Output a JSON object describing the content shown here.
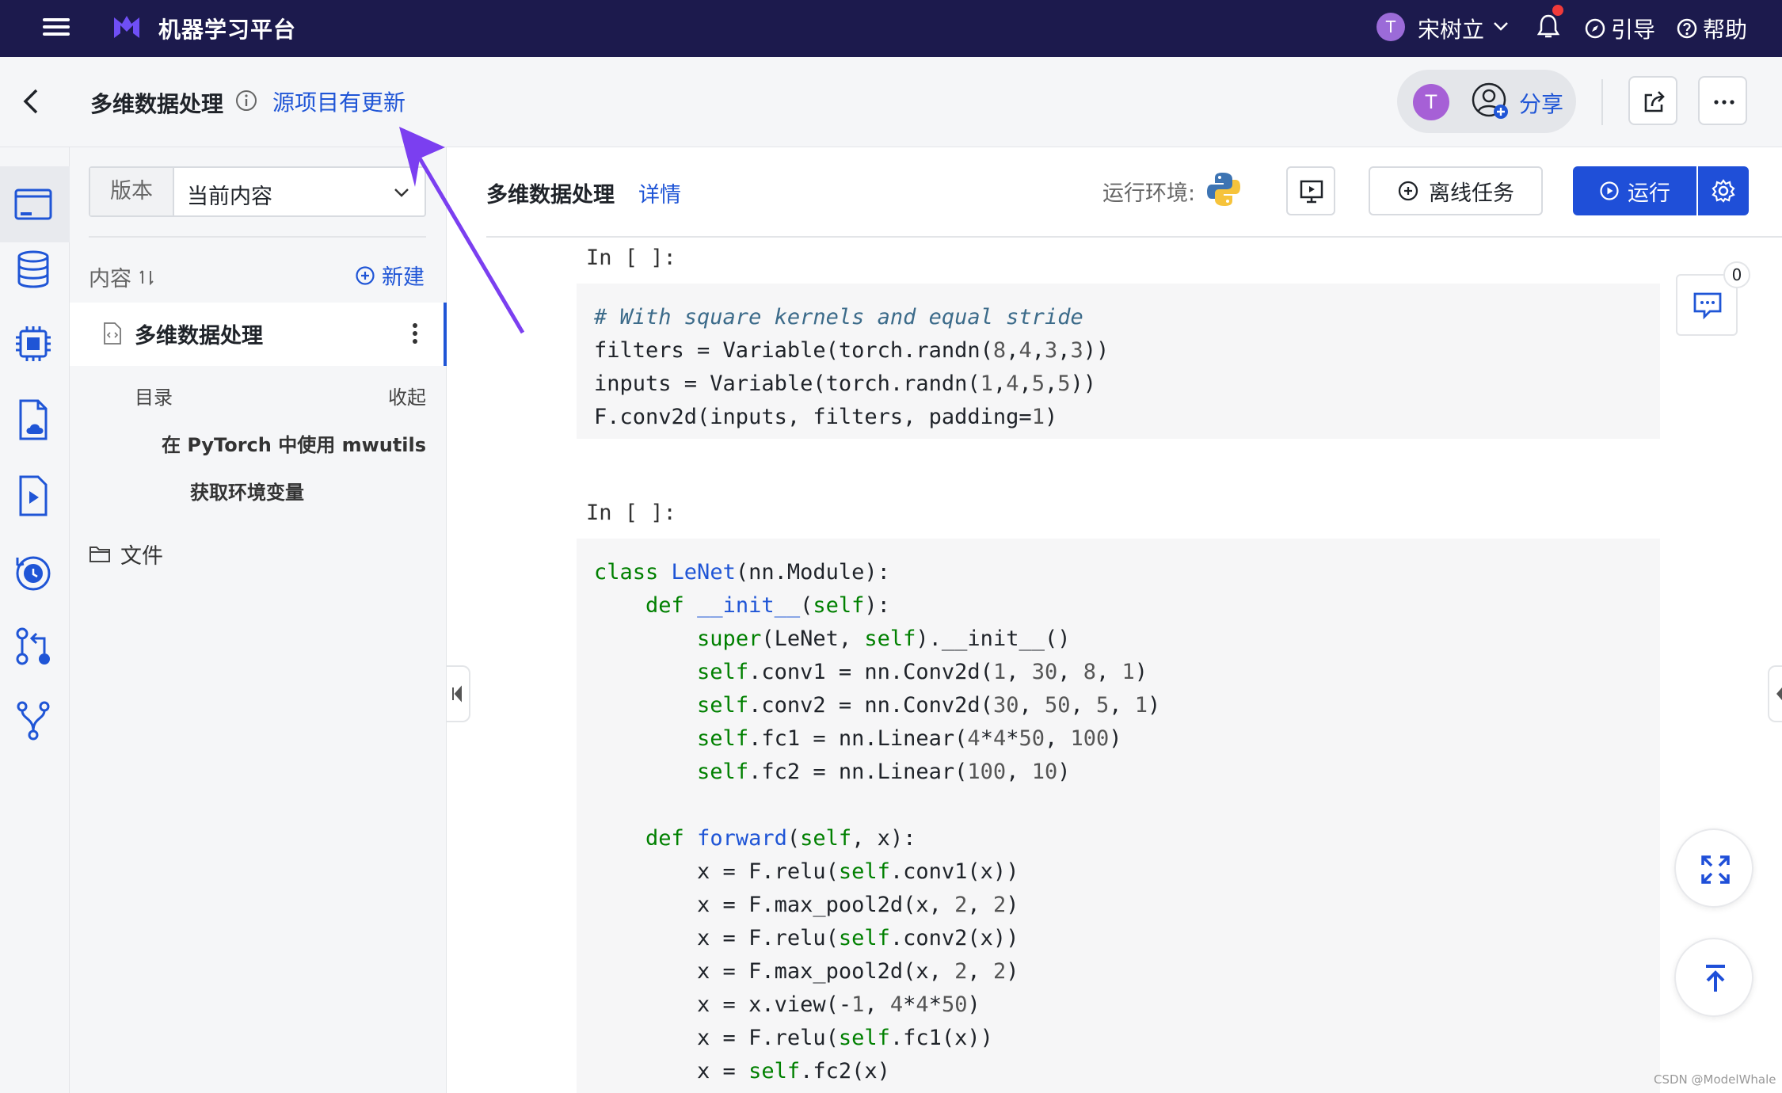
{
  "topbar": {
    "app_title": "机器学习平台",
    "user_initial": "T",
    "user_name": "宋树立",
    "guide_label": "引导",
    "help_label": "帮助"
  },
  "header": {
    "project_title": "多维数据处理",
    "update_link": "源项目有更新",
    "share_initial": "T",
    "share_label": "分享"
  },
  "sidebar": {
    "version_label": "版本",
    "version_value": "当前内容",
    "content_label": "内容",
    "new_label": "新建",
    "file_name": "多维数据处理",
    "toc_label": "目录",
    "toc_collapse": "收起",
    "toc_items": [
      "在 PyTorch 中使用 mwutils",
      "获取环境变量"
    ],
    "files_label": "文件"
  },
  "notebook": {
    "title": "多维数据处理",
    "detail_link": "详情",
    "env_label": "运行环境:",
    "offline_label": "离线任务",
    "run_label": "运行",
    "comment_count": "0",
    "cells": [
      {
        "prompt": "In [ ]:"
      },
      {
        "prompt": "In [ ]:"
      }
    ]
  },
  "watermark": "CSDN @ModelWhale",
  "colors": {
    "topbar_bg": "#1c1a4d",
    "accent": "#1f55d6",
    "run_button": "#1f4fd8",
    "annotation_arrow": "#7b3ff0"
  }
}
